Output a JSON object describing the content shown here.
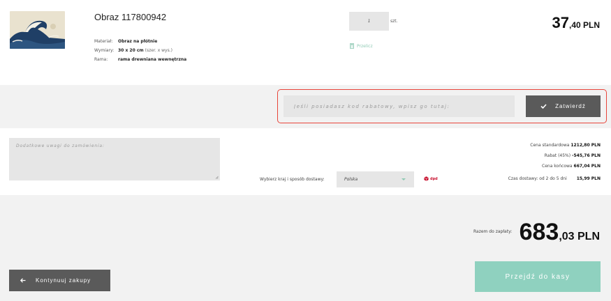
{
  "product": {
    "title": "Obraz 117800942",
    "thumbnail_icon": "great-wave-painting-thumbnail",
    "specs": [
      {
        "label": "Materiał:",
        "value": "Obraz na płótnie",
        "note": ""
      },
      {
        "label": "Wymiary:",
        "value": "30 x 20 cm",
        "note": "(szer. x wys.)"
      },
      {
        "label": "Rama:",
        "value": "rama drewniana wewnętrzna",
        "note": ""
      }
    ],
    "quantity": "1",
    "unit": "szt.",
    "recalc_label": "Przelicz",
    "price_int": "37",
    "price_dec": ",40 PLN"
  },
  "coupon": {
    "placeholder": "Jeśli posiadasz kod rabatowy, wpisz go tutaj:",
    "button_label": "Zatwierdź"
  },
  "notes": {
    "placeholder": "Dodatkowe uwagi do zamówienia:"
  },
  "shipping": {
    "label": "Wybierz kraj i sposób dostawy:",
    "country": "Polska",
    "carrier": "dpd",
    "delivery_time_label": "Czas dostawy: od 2 do 5 dni",
    "delivery_price": "15,99 PLN"
  },
  "summary": {
    "standard_label": "Cena standardowa",
    "standard_value": "1212,80 PLN",
    "discount_label": "Rabat (45%)",
    "discount_value": "-545,76 PLN",
    "final_label": "Cena końcowa",
    "final_value": "667,04 PLN"
  },
  "total": {
    "label": "Razem do zapłaty:",
    "int": "683",
    "dec": ",03 PLN"
  },
  "actions": {
    "back_label": "Kontynuuj zakupy",
    "checkout_label": "Przejdź do kasy"
  },
  "colors": {
    "accent_green": "#8fd1bf",
    "dark_button": "#5a5a5a",
    "highlight_red": "#e8453a",
    "panel_grey": "#f2f2f2"
  }
}
